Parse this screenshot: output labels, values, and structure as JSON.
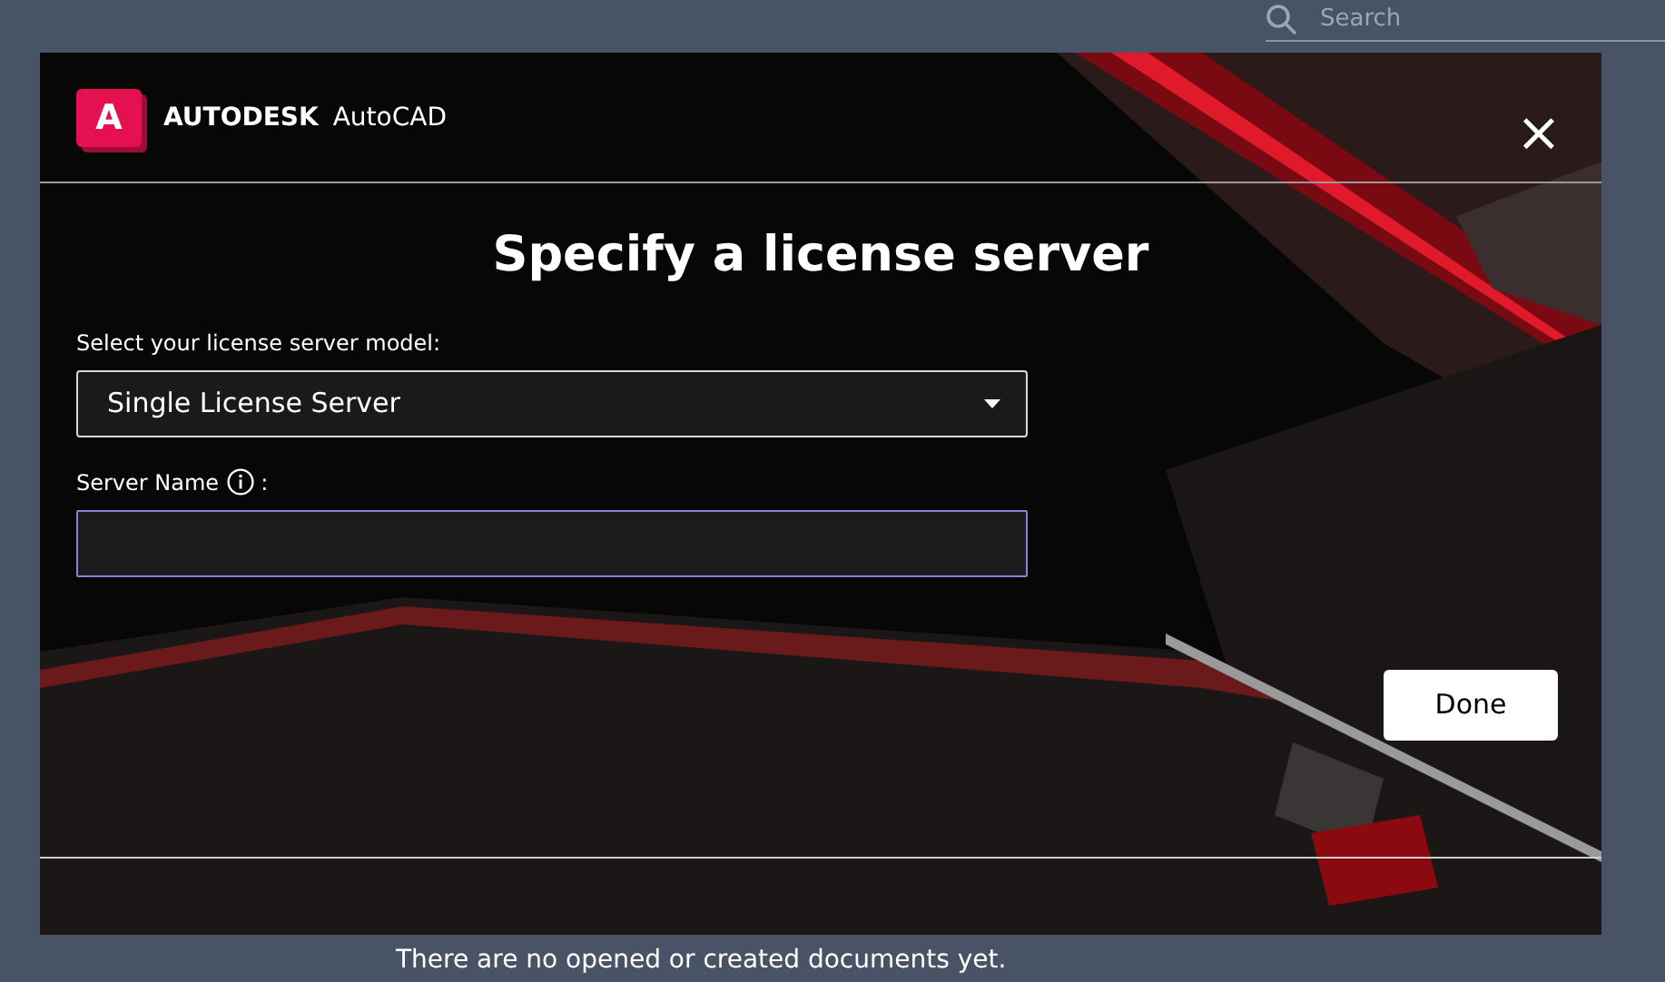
{
  "background": {
    "search": {
      "placeholder": "Search"
    },
    "empty_message": "There are no opened or created documents yet."
  },
  "dialog": {
    "brand": {
      "logo_letter": "A",
      "company": "AUTODESK",
      "product": "AutoCAD"
    },
    "close": "×",
    "title": "Specify a license server",
    "model_label": "Select your license server model:",
    "model_value": "Single License Server",
    "server_label": "Server Name",
    "server_label_suffix": ":",
    "server_field": {
      "focused": true
    },
    "done_button": "Done"
  }
}
